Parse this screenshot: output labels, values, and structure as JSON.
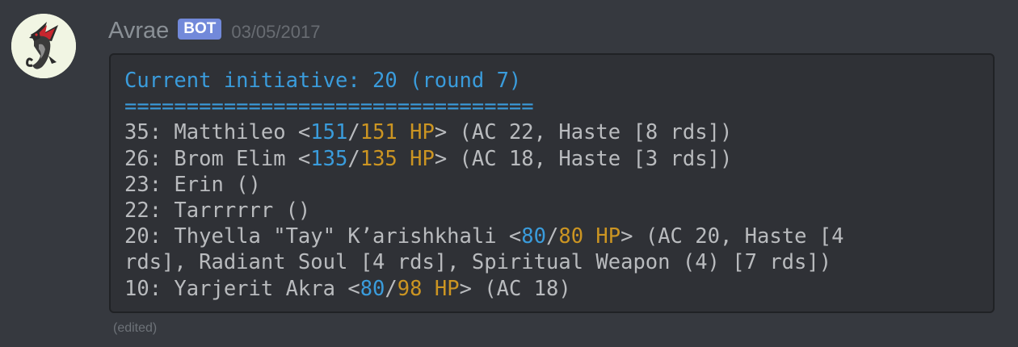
{
  "message": {
    "username": "Avrae",
    "bot_tag": "BOT",
    "timestamp": "03/05/2017",
    "edited_label": "(edited)"
  },
  "colors": {
    "background": "#36393f",
    "codeblock_bg": "#2f3136",
    "current_hp": "#3a9cdc",
    "max_hp": "#cc9522",
    "bot_tag": "#7289da"
  },
  "initiative": {
    "header": "Current initiative: 20 (round 7)",
    "divider": "=================================",
    "combatants": [
      {
        "prefix": "35: Matthileo <",
        "hp": "151",
        "sep": "/",
        "max_hp": "151",
        "hp_label": " HP",
        "suffix": "> (AC 22, Haste [8 rds])"
      },
      {
        "prefix": "26: Brom Elim <",
        "hp": "135",
        "sep": "/",
        "max_hp": "135",
        "hp_label": " HP",
        "suffix": "> (AC 18, Haste [3 rds])"
      },
      {
        "text": "23: Erin ()"
      },
      {
        "text": "22: Tarrrrrr ()"
      },
      {
        "prefix": "20: Thyella \"Tay\" K’arishkhali <",
        "hp": "80",
        "sep": "/",
        "max_hp": "80",
        "hp_label": " HP",
        "suffix": "> (AC 20, Haste [4",
        "continuation": "rds], Radiant Soul [4 rds], Spiritual Weapon (4) [7 rds])"
      },
      {
        "prefix": "10: Yarjerit Akra <",
        "hp": "80",
        "sep": "/",
        "max_hp": "98",
        "hp_label": " HP",
        "suffix": "> (AC 18)"
      }
    ]
  },
  "icons": {
    "avatar": "dragon-avatar-icon"
  }
}
